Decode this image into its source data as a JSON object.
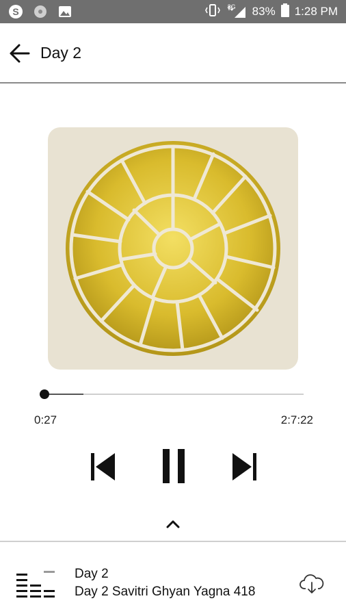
{
  "status_bar": {
    "left_icons": [
      "skype-icon",
      "record-icon",
      "image-icon"
    ],
    "network": "3G",
    "battery": "83%",
    "time": "1:28 PM"
  },
  "header": {
    "title": "Day 2"
  },
  "player": {
    "current_time": "0:27",
    "total_time": "2:7:22",
    "progress_fraction": 0.003,
    "controls": [
      "skip-previous",
      "pause",
      "skip-next"
    ]
  },
  "mini_player": {
    "title": "Day 2",
    "subtitle": "Day 2 Savitri Ghyan Yagna 418"
  },
  "colors": {
    "status_bar": "#6f6f6f",
    "artwork_bg": "#e8e2d2",
    "gold": "#d4b62c",
    "gold_dark": "#9e8412",
    "divider": "#8a8a8a"
  }
}
